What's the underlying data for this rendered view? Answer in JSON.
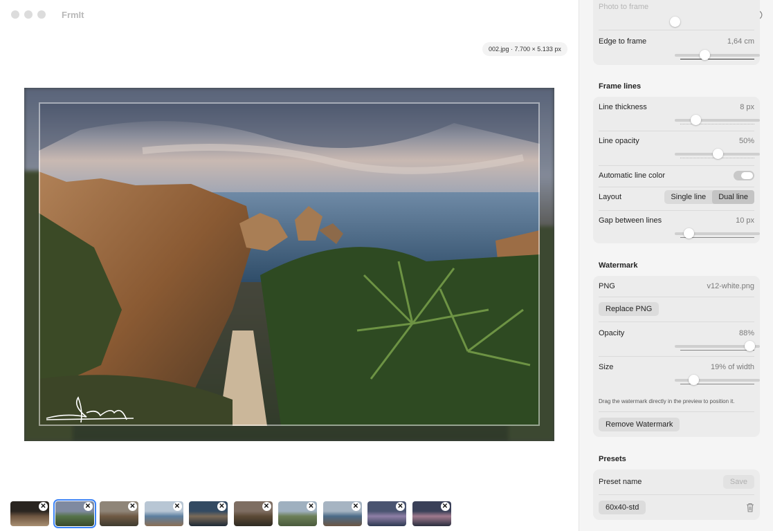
{
  "app": {
    "title": "FrmIt"
  },
  "file_badge": "002.jpg · 7.700 × 5.133 px",
  "toolbar": {
    "icons": [
      "image-settings-icon",
      "share-icon",
      "print-icon",
      "reset-icon"
    ]
  },
  "sidebar": {
    "top_card": {
      "photo_to_frame_label": "Photo to frame",
      "edge_to_frame_label": "Edge to frame",
      "edge_to_frame_value": "1,64 cm",
      "edge_to_frame_level": 0.35
    },
    "frame_lines": {
      "title": "Frame lines",
      "line_thickness_label": "Line thickness",
      "line_thickness_value": "8 px",
      "line_thickness_level": 0.24,
      "line_opacity_label": "Line opacity",
      "line_opacity_value": "50%",
      "line_opacity_level": 0.5,
      "auto_color_label": "Automatic line color",
      "auto_color_on": true,
      "layout_label": "Layout",
      "layout_options": [
        "Single line",
        "Dual line"
      ],
      "layout_selected": "Dual line",
      "gap_label": "Gap between lines",
      "gap_value": "10 px",
      "gap_level": 0.16
    },
    "watermark": {
      "title": "Watermark",
      "png_label": "PNG",
      "png_value": "v12-white.png",
      "replace_label": "Replace PNG",
      "opacity_label": "Opacity",
      "opacity_value": "88%",
      "opacity_level": 0.88,
      "size_label": "Size",
      "size_value": "19% of width",
      "size_level": 0.22,
      "hint": "Drag the watermark directly in the preview to position it.",
      "remove_label": "Remove Watermark"
    },
    "presets": {
      "title": "Presets",
      "name_label": "Preset name",
      "save_label": "Save",
      "preset_chip": "60x40-std"
    }
  },
  "colors": {
    "accent": "#3b82f6",
    "sidebar_bg": "#f5f5f5",
    "card_bg": "#ececec"
  },
  "filmstrip": {
    "selected_index": 1,
    "thumbs": [
      {
        "name": "thumb-1"
      },
      {
        "name": "thumb-2"
      },
      {
        "name": "thumb-3"
      },
      {
        "name": "thumb-4"
      },
      {
        "name": "thumb-5"
      },
      {
        "name": "thumb-6"
      },
      {
        "name": "thumb-7"
      },
      {
        "name": "thumb-8"
      },
      {
        "name": "thumb-9"
      },
      {
        "name": "thumb-10"
      }
    ],
    "remove_glyph": "✕"
  }
}
